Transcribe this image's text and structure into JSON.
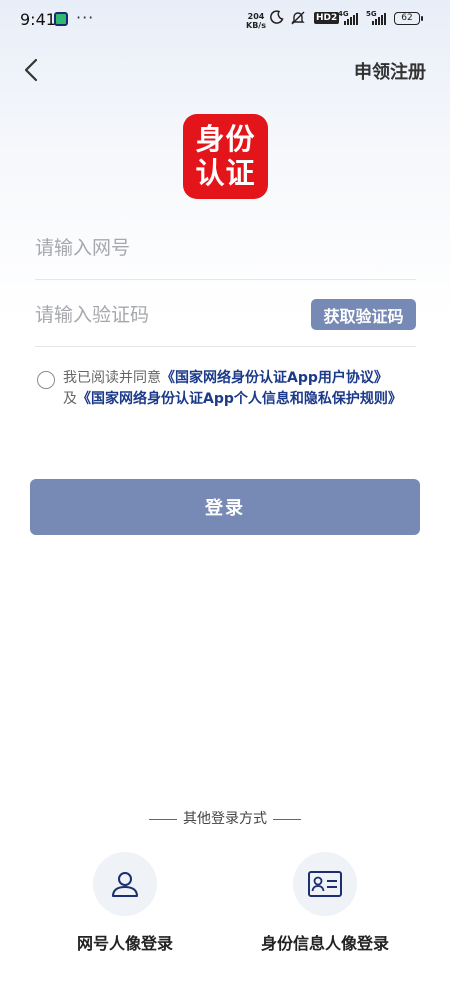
{
  "status_bar": {
    "time": "9:41",
    "speed_value": "204",
    "speed_unit": "KB/s",
    "hd_label": "HD2",
    "net1": "4G",
    "net2": "5G",
    "battery": "62"
  },
  "header": {
    "register_label": "申领注册"
  },
  "logo": {
    "line1": "身份",
    "line2": "认证"
  },
  "form": {
    "account_placeholder": "请输入网号",
    "code_placeholder": "请输入验证码",
    "get_code_label": "获取验证码"
  },
  "agreement": {
    "prefix": "我已阅读并同意",
    "link1": "《国家网络身份认证App用户协议》",
    "connector": "及",
    "link2": "《国家网络身份认证App个人信息和隐私保护规则》"
  },
  "login_label": "登录",
  "other_login": {
    "title": "其他登录方式",
    "options": [
      {
        "label": "网号人像登录",
        "icon": "person-icon"
      },
      {
        "label": "身份信息人像登录",
        "icon": "id-card-icon"
      }
    ]
  },
  "colors": {
    "primary": "#7789b5",
    "link": "#1c3a8a",
    "logo_red": "#e3141a"
  }
}
